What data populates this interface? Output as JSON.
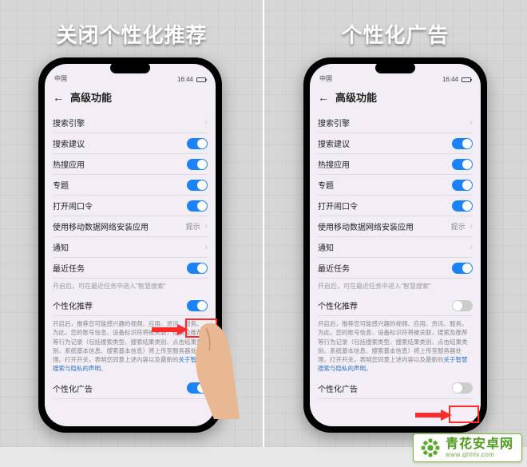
{
  "titles": {
    "left": "关闭个性化推荐",
    "right": "个性化广告"
  },
  "status": {
    "carrier": "中国",
    "time": "16:44"
  },
  "header": {
    "title": "高级功能"
  },
  "rows": {
    "searchEngine": "搜索引擎",
    "searchSuggest": "搜索建议",
    "hotApps": "热搜应用",
    "special": "专题",
    "openCmd": "打开闹口令",
    "mobileData": "使用移动数据网络安装应用",
    "mobileDataVal": "提示",
    "notify": "通知",
    "recentTasks": "最近任务",
    "recentHint": "开启后，可在最近任务中进入\"智慧搜索\"",
    "personalRec": "个性化推荐",
    "longDesc": "开启后，推荐您可能感兴趣的视频、应用、资讯、服务。为此，您的账号信息、设备标识符将被关联，搜索及推荐等行为记录（包括搜索类型、搜索结果类别、点击结果类别、系统基本信息、搜索基本信息）将上传至服务器处理。打开开关，表明您同意上述内容以及最新的",
    "policyLink": "关于智慧搜索与隐私的声明",
    "period": "。",
    "personalAds": "个性化广告"
  },
  "watermark": {
    "zh": "青花安卓网",
    "py": "www.qhhlv.com"
  }
}
